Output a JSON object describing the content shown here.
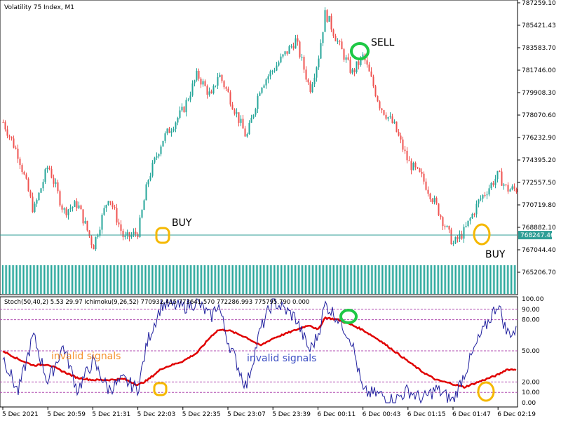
{
  "window": {
    "title": "Volatility 75 Index, M1"
  },
  "price_axis": {
    "labels": [
      "787259.10",
      "785421.43",
      "783583.70",
      "781746.00",
      "779908.30",
      "778070.60",
      "776232.90",
      "774395.20",
      "772557.50",
      "770719.80",
      "768882.10",
      "767044.40",
      "765206.70"
    ],
    "current_price_label": "768247.46"
  },
  "indicator": {
    "header": "Stoch(50,40,2) 5.53 29.97 Ichimoku(9,26,52) 770932.415 773641.570 772286.993 775795.790 0.000",
    "levels": [
      "100.00",
      "90.00",
      "80.00",
      "50.00",
      "20.00",
      "10.00",
      "0.00"
    ]
  },
  "time_axis": {
    "labels": [
      "5 Dec 2021",
      "5 Dec 20:59",
      "5 Dec 21:31",
      "5 Dec 22:03",
      "5 Dec 22:35",
      "5 Dec 23:07",
      "5 Dec 23:39",
      "6 Dec 00:11",
      "6 Dec 00:43",
      "6 Dec 01:15",
      "6 Dec 01:47",
      "6 Dec 02:19"
    ]
  },
  "annotations": {
    "buy_left": "BUY",
    "sell": "SELL",
    "buy_right": "BUY",
    "invalid_orange": "invalid signals",
    "invalid_blue": "invalid signals"
  },
  "colors": {
    "bull_candle": "#26a69a",
    "bear_candle": "#ef5350",
    "stoch_main": "#1f1f9e",
    "stoch_signal": "#e00000",
    "level_line": "#b04cb0",
    "current_price": "#2e9e96",
    "marker_yellow": "#f5b800",
    "marker_green": "#1ec845",
    "invalid_orange": "#f5922e",
    "invalid_blue": "#3d4fc4"
  },
  "chart_data": [
    {
      "type": "candlestick",
      "title": "Volatility 75 Index, M1",
      "ylim": [
        764500,
        787800
      ],
      "y_ticks": [
        787259.1,
        785421.43,
        783583.7,
        781746.0,
        779908.3,
        778070.6,
        776232.9,
        774395.2,
        772557.5,
        770719.8,
        768882.1,
        767044.4,
        765206.7
      ],
      "current_price": 768247.46,
      "x_ticks": [
        "5 Dec 2021",
        "5 Dec 20:59",
        "5 Dec 21:31",
        "5 Dec 22:03",
        "5 Dec 22:35",
        "5 Dec 23:07",
        "5 Dec 23:39",
        "6 Dec 00:11",
        "6 Dec 00:43",
        "6 Dec 01:15",
        "6 Dec 01:47",
        "6 Dec 02:19"
      ],
      "path_close": [
        [
          "5 Dec 2021",
          777500
        ],
        [
          "5 Dec 20:20",
          774800
        ],
        [
          "5 Dec 20:40",
          770200
        ],
        [
          "5 Dec 20:59",
          774000
        ],
        [
          "5 Dec 21:10",
          770200
        ],
        [
          "5 Dec 21:20",
          770800
        ],
        [
          "5 Dec 21:31",
          767300
        ],
        [
          "5 Dec 21:42",
          771500
        ],
        [
          "5 Dec 21:53",
          767900
        ],
        [
          "5 Dec 22:03",
          768500
        ],
        [
          "5 Dec 22:10",
          772800
        ],
        [
          "5 Dec 22:20",
          776000
        ],
        [
          "5 Dec 22:35",
          778500
        ],
        [
          "5 Dec 22:45",
          781400
        ],
        [
          "5 Dec 22:55",
          779500
        ],
        [
          "5 Dec 23:00",
          781500
        ],
        [
          "5 Dec 23:07",
          779800
        ],
        [
          "5 Dec 23:20",
          776200
        ],
        [
          "5 Dec 23:30",
          780500
        ],
        [
          "5 Dec 23:39",
          781800
        ],
        [
          "5 Dec 23:55",
          784200
        ],
        [
          "6 Dec 00:05",
          780200
        ],
        [
          "6 Dec 00:11",
          782700
        ],
        [
          "6 Dec 00:16",
          786500
        ],
        [
          "6 Dec 00:25",
          784000
        ],
        [
          "6 Dec 00:35",
          781500
        ],
        [
          "6 Dec 00:43",
          782900
        ],
        [
          "6 Dec 00:55",
          778800
        ],
        [
          "6 Dec 01:05",
          777200
        ],
        [
          "6 Dec 01:15",
          774200
        ],
        [
          "6 Dec 01:25",
          772900
        ],
        [
          "6 Dec 01:35",
          770600
        ],
        [
          "6 Dec 01:47",
          767500
        ],
        [
          "6 Dec 01:55",
          768600
        ],
        [
          "6 Dec 02:05",
          771000
        ],
        [
          "6 Dec 02:19",
          773200
        ],
        [
          "6 Dec 02:25",
          772000
        ]
      ]
    },
    {
      "type": "line",
      "title": "Stoch(50,40,2) Ichimoku(9,26,52)",
      "ylim": [
        0,
        100
      ],
      "levels": [
        100,
        90,
        80,
        50,
        20,
        10,
        0
      ],
      "series": [
        {
          "name": "Stoch main",
          "points": [
            [
              "5 Dec 2021",
              45
            ],
            [
              "5 Dec 20:20",
              10
            ],
            [
              "5 Dec 20:40",
              65
            ],
            [
              "5 Dec 20:59",
              20
            ],
            [
              "5 Dec 21:10",
              55
            ],
            [
              "5 Dec 21:20",
              12
            ],
            [
              "5 Dec 21:31",
              40
            ],
            [
              "5 Dec 21:42",
              13
            ],
            [
              "5 Dec 21:53",
              22
            ],
            [
              "5 Dec 22:03",
              13
            ],
            [
              "5 Dec 22:10",
              60
            ],
            [
              "5 Dec 22:20",
              95
            ],
            [
              "5 Dec 22:35",
              92
            ],
            [
              "5 Dec 22:45",
              97
            ],
            [
              "5 Dec 22:55",
              82
            ],
            [
              "5 Dec 23:00",
              96
            ],
            [
              "5 Dec 23:07",
              60
            ],
            [
              "5 Dec 23:20",
              15
            ],
            [
              "5 Dec 23:30",
              70
            ],
            [
              "5 Dec 23:39",
              98
            ],
            [
              "5 Dec 23:55",
              82
            ],
            [
              "6 Dec 00:05",
              50
            ],
            [
              "6 Dec 00:11",
              65
            ],
            [
              "6 Dec 00:16",
              95
            ],
            [
              "6 Dec 00:25",
              82
            ],
            [
              "6 Dec 00:35",
              60
            ],
            [
              "6 Dec 00:43",
              10
            ],
            [
              "6 Dec 00:55",
              8
            ],
            [
              "6 Dec 01:05",
              2
            ],
            [
              "6 Dec 01:15",
              12
            ],
            [
              "6 Dec 01:25",
              3
            ],
            [
              "6 Dec 01:35",
              13
            ],
            [
              "6 Dec 01:47",
              2
            ],
            [
              "6 Dec 01:55",
              28
            ],
            [
              "6 Dec 02:05",
              60
            ],
            [
              "6 Dec 02:19",
              96
            ],
            [
              "6 Dec 02:25",
              68
            ]
          ]
        },
        {
          "name": "Stoch signal",
          "points": [
            [
              "5 Dec 2021",
              50
            ],
            [
              "5 Dec 20:20",
              42
            ],
            [
              "5 Dec 20:40",
              36
            ],
            [
              "5 Dec 20:59",
              37
            ],
            [
              "5 Dec 21:10",
              30
            ],
            [
              "5 Dec 21:20",
              24
            ],
            [
              "5 Dec 21:31",
              22
            ],
            [
              "5 Dec 21:42",
              22
            ],
            [
              "5 Dec 21:53",
              23
            ],
            [
              "5 Dec 22:03",
              17
            ],
            [
              "5 Dec 22:10",
              22
            ],
            [
              "5 Dec 22:20",
              33
            ],
            [
              "5 Dec 22:35",
              40
            ],
            [
              "5 Dec 22:45",
              48
            ],
            [
              "5 Dec 22:55",
              64
            ],
            [
              "5 Dec 23:00",
              70
            ],
            [
              "5 Dec 23:07",
              70
            ],
            [
              "5 Dec 23:20",
              63
            ],
            [
              "5 Dec 23:30",
              55
            ],
            [
              "5 Dec 23:39",
              62
            ],
            [
              "5 Dec 23:55",
              70
            ],
            [
              "6 Dec 00:05",
              75
            ],
            [
              "6 Dec 00:11",
              70
            ],
            [
              "6 Dec 00:16",
              82
            ],
            [
              "6 Dec 00:25",
              80
            ],
            [
              "6 Dec 00:35",
              75
            ],
            [
              "6 Dec 00:43",
              70
            ],
            [
              "6 Dec 00:55",
              60
            ],
            [
              "6 Dec 01:05",
              50
            ],
            [
              "6 Dec 01:15",
              40
            ],
            [
              "6 Dec 01:25",
              30
            ],
            [
              "6 Dec 01:35",
              22
            ],
            [
              "6 Dec 01:47",
              18
            ],
            [
              "6 Dec 01:55",
              15
            ],
            [
              "6 Dec 02:05",
              20
            ],
            [
              "6 Dec 02:19",
              27
            ],
            [
              "6 Dec 02:25",
              32
            ]
          ]
        }
      ]
    }
  ]
}
